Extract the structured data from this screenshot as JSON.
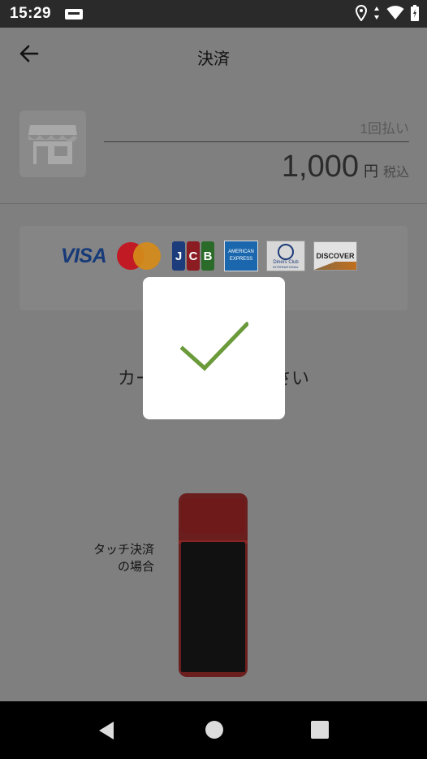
{
  "status_bar": {
    "time": "15:29",
    "icons": [
      "notification-icon",
      "location-icon",
      "data-arrows-icon",
      "wifi-icon",
      "battery-icon"
    ]
  },
  "app_bar": {
    "title": "決済",
    "back_icon": "arrow-back-icon"
  },
  "merchant": {
    "icon": "store-icon",
    "payment_type": "1回払い",
    "amount": "1,000",
    "currency": "円",
    "tax_label": "税込"
  },
  "card_brands": {
    "visa": "VISA",
    "mastercard": "mastercard-logo",
    "jcb": [
      "J",
      "C",
      "B"
    ],
    "amex": [
      "AMERICAN",
      "EXPRESS"
    ],
    "diners": [
      "Diners Club",
      "INTERNATIONAL"
    ],
    "discover": "DISCOVER"
  },
  "instruction": {
    "left": "カー",
    "right": "さい"
  },
  "touch_payment": {
    "line1": "タッチ決済",
    "line2": "の場合"
  },
  "success_dialog": {
    "icon": "checkmark-icon",
    "color": "#6a9a3a"
  },
  "nav_bar": {
    "back": "nav-back-icon",
    "home": "nav-home-icon",
    "recent": "nav-recent-icon"
  }
}
